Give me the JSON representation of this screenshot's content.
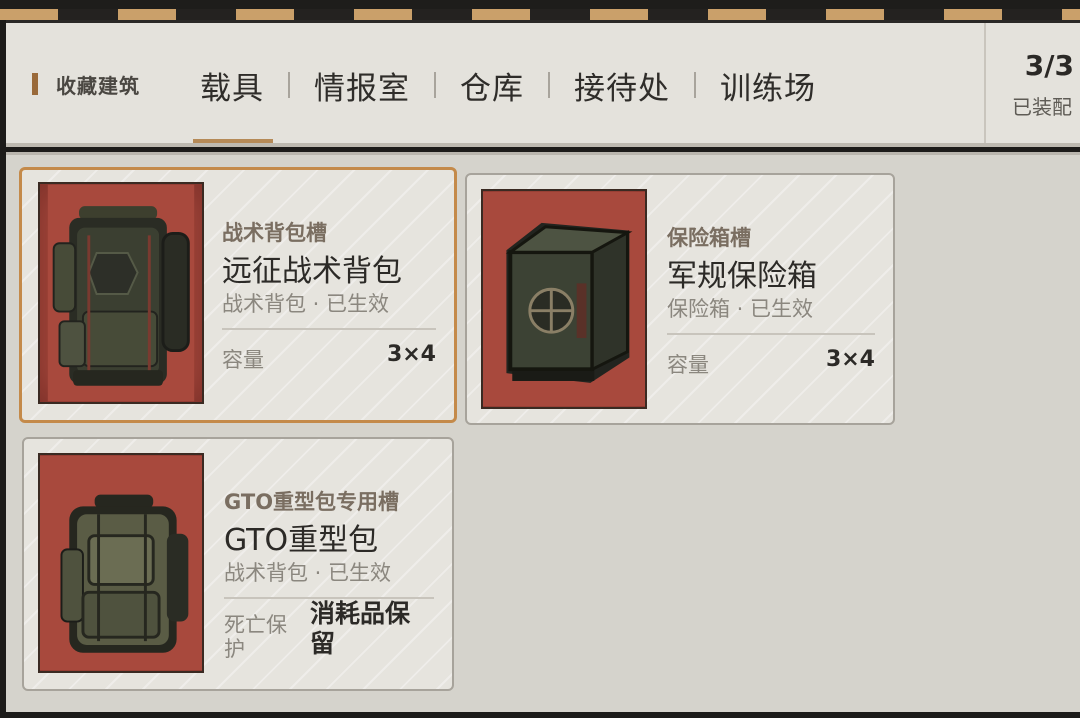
{
  "header": {
    "section_label": "收藏建筑",
    "tabs": [
      {
        "label": "载具",
        "active": true
      },
      {
        "label": "情报室",
        "active": false
      },
      {
        "label": "仓库",
        "active": false
      },
      {
        "label": "接待处",
        "active": false
      },
      {
        "label": "训练场",
        "active": false
      }
    ],
    "capacity": {
      "value": "3/3",
      "label": "已装配"
    }
  },
  "slots": [
    {
      "slot_name": "战术背包槽",
      "item_name": "远征战术背包",
      "item_sub": "战术背包 · 已生效",
      "stat_label": "容量",
      "stat_value": "3×4",
      "selected": true,
      "icon": "tactical-backpack-icon"
    },
    {
      "slot_name": "保险箱槽",
      "item_name": "军规保险箱",
      "item_sub": "保险箱 · 已生效",
      "stat_label": "容量",
      "stat_value": "3×4",
      "selected": false,
      "icon": "safe-box-icon"
    },
    {
      "slot_name": "GTO重型包专用槽",
      "item_name": "GTO重型包",
      "item_sub": "战术背包 · 已生效",
      "stat_label": "死亡保护",
      "stat_value": "消耗品保留",
      "selected": false,
      "icon": "heavy-backpack-icon"
    }
  ],
  "colors": {
    "accent": "#c48a4a",
    "thumb_bg": "#a8493d",
    "panel_bg": "#d5d3cc"
  }
}
